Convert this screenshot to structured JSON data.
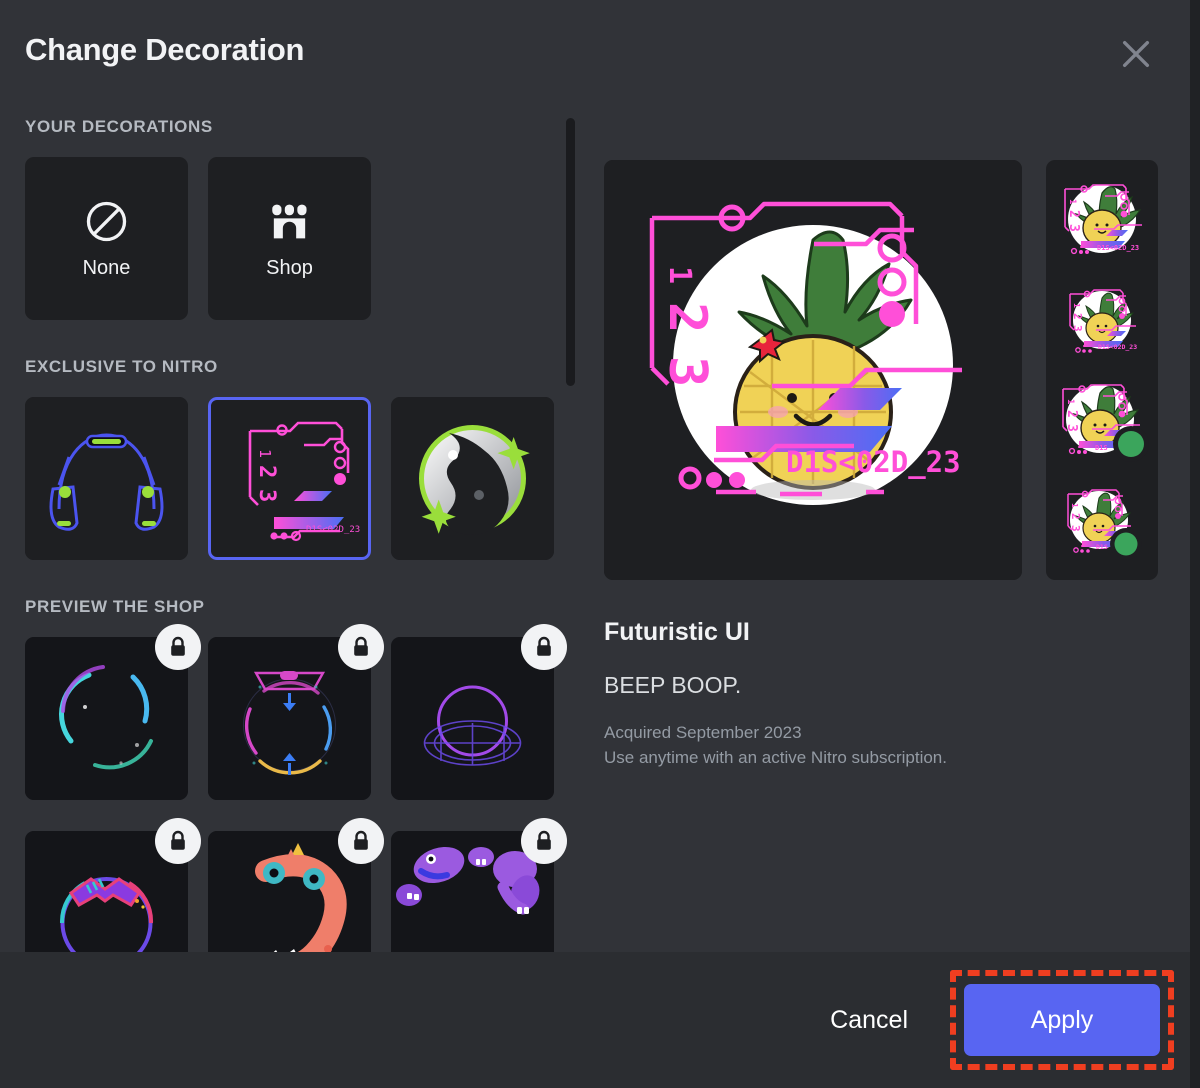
{
  "modal": {
    "title": "Change Decoration",
    "close_icon": "close-icon"
  },
  "sections": [
    {
      "id": "your-decorations",
      "heading": "YOUR DECORATIONS",
      "items": [
        {
          "label": "None",
          "icon": "no-entry-icon",
          "art": "none"
        },
        {
          "label": "Shop",
          "icon": "storefront-icon",
          "art": "shop"
        }
      ]
    },
    {
      "id": "exclusive-to-nitro",
      "heading": "EXCLUSIVE TO NITRO",
      "items": [
        {
          "label": "Headphones",
          "art": "headphones",
          "selected": false,
          "locked": false
        },
        {
          "label": "Futuristic UI",
          "art": "futuristic",
          "selected": true,
          "locked": false
        },
        {
          "label": "Moon",
          "art": "moon",
          "selected": false,
          "locked": false
        }
      ]
    },
    {
      "id": "preview-the-shop",
      "heading": "PREVIEW THE SHOP",
      "items": [
        {
          "label": "Neon Arcs",
          "art": "neon-arcs",
          "locked": true
        },
        {
          "label": "Sci-Fi Ring",
          "art": "scifi-ring",
          "locked": true
        },
        {
          "label": "Synth Grid",
          "art": "synth-grid",
          "locked": true
        },
        {
          "label": "Neon Band",
          "art": "neon-band",
          "locked": true
        },
        {
          "label": "Dino",
          "art": "dino",
          "locked": true
        },
        {
          "label": "Purple Creatures",
          "art": "creatures",
          "locked": true
        }
      ]
    }
  ],
  "preview": {
    "avatar_name": "pineapple-avatar",
    "decoration_text": "D1S<02D_23",
    "frame_digits": [
      "1",
      "2",
      "3"
    ],
    "thumbnails": [
      {
        "name": "thumb-large-no-status",
        "status": false,
        "size": "large"
      },
      {
        "name": "thumb-medium-no-status",
        "status": false,
        "size": "medium"
      },
      {
        "name": "thumb-large-online",
        "status": true,
        "size": "large"
      },
      {
        "name": "thumb-medium-online",
        "status": true,
        "size": "medium"
      }
    ]
  },
  "detail": {
    "title": "Futuristic UI",
    "subtitle": "BEEP BOOP.",
    "acquired": "Acquired September 2023",
    "usage": "Use anytime with an active Nitro subscription."
  },
  "footer": {
    "cancel_label": "Cancel",
    "apply_label": "Apply"
  },
  "colors": {
    "modal_bg": "#313338",
    "tile_bg": "#1e1f22",
    "footer_bg": "#2b2d31",
    "accent_blurple": "#5865f2",
    "heading_gray": "#b5bac1",
    "muted_text": "#949ba4",
    "annotation_red": "#ef3e20",
    "status_online": "#3ba55c",
    "deco_pink": "#ff4fd8"
  }
}
